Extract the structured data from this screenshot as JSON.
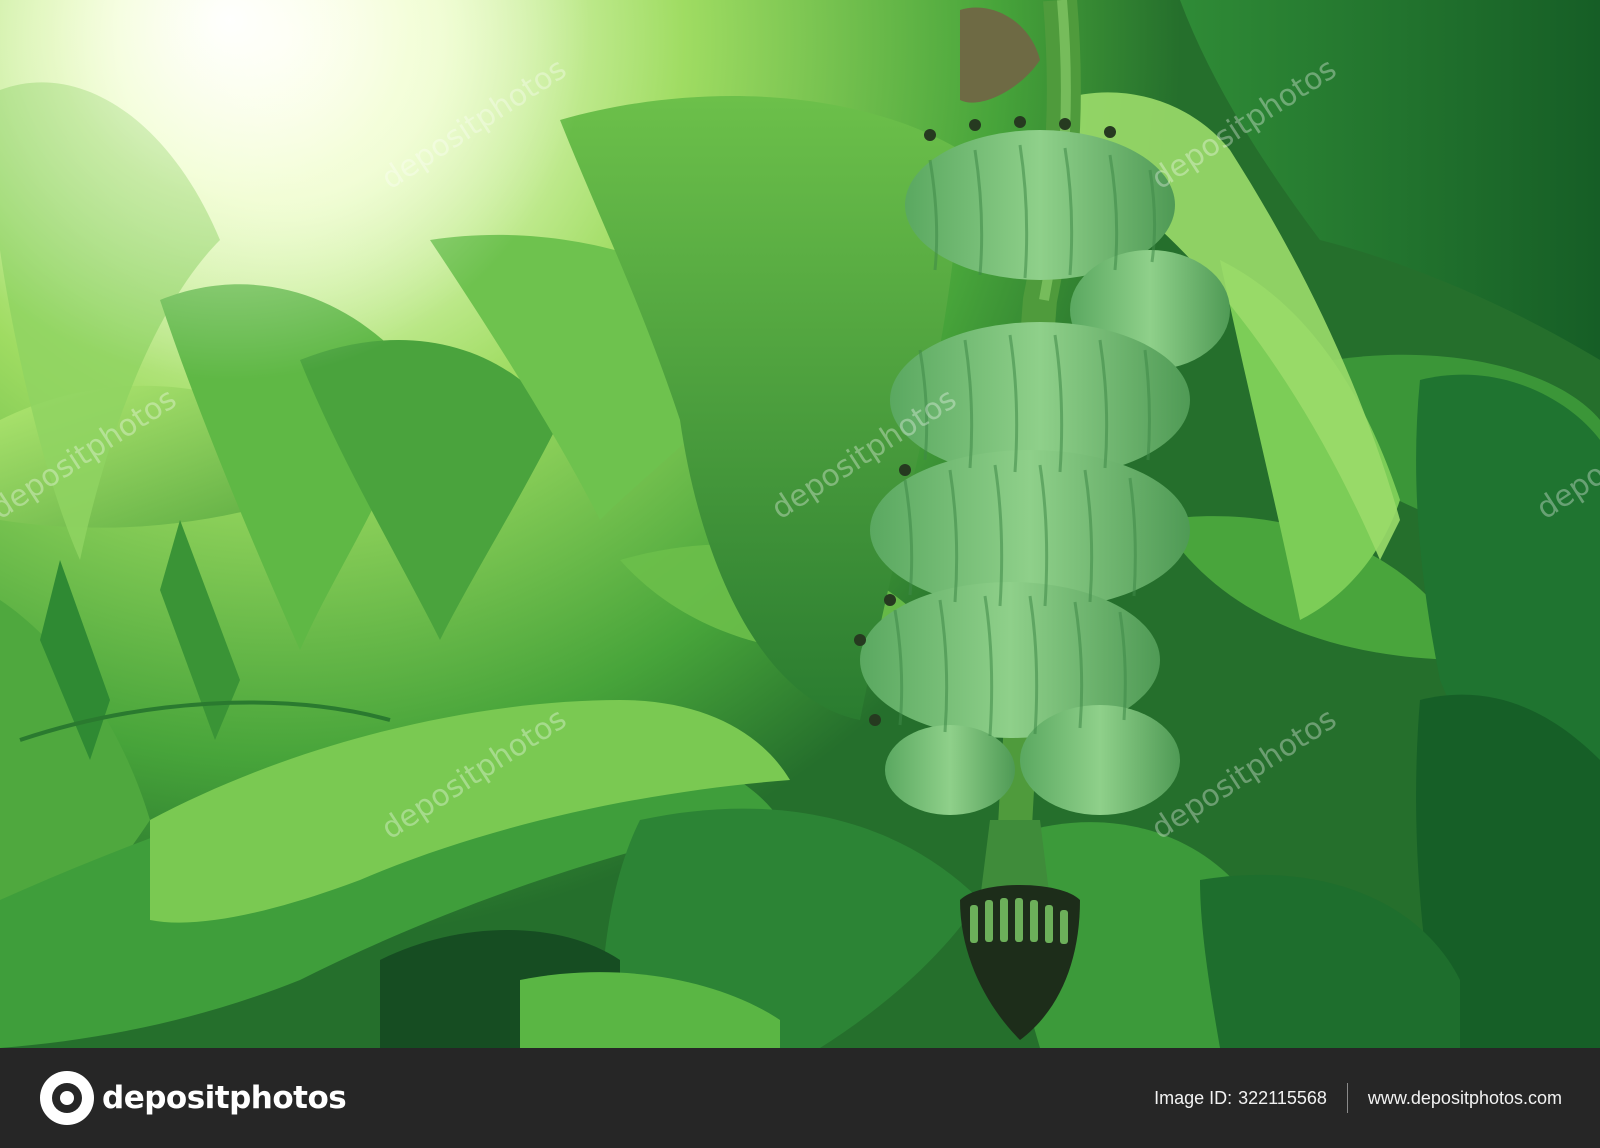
{
  "photo": {
    "subject_icon": "banana-bunch-icon",
    "palette": {
      "sky": "#fbfff0",
      "leaf_light": "#9fe05a",
      "leaf_mid": "#4caf3c",
      "leaf_dark": "#1f6b2a",
      "banana": "#7cc07a",
      "stem": "#5aa345",
      "flower": "#1a2a18"
    }
  },
  "watermark": {
    "text": "depositphotos"
  },
  "footer": {
    "logo_icon": "depositphotos-logo-icon",
    "brand": "depositphotos",
    "image_id_label": "Image ID:",
    "image_id": "322115568",
    "site_url": "www.depositphotos.com",
    "background": "#262626"
  }
}
